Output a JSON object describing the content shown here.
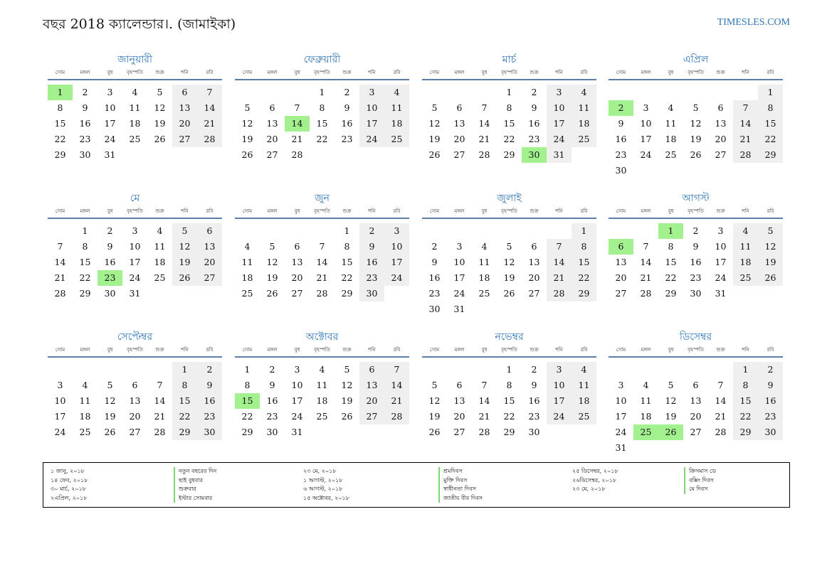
{
  "header": {
    "title": "বছর 2018 ক্যালেন্ডার।. (জামাইকা)",
    "site": "TIMESLES.COM"
  },
  "weekdays": [
    "সোম",
    "মঙ্গল",
    "বুধ",
    "বৃহস্পতি",
    "শুক্র",
    "শনি",
    "রবি"
  ],
  "months": [
    {
      "name": "জানুয়ারী",
      "start": 0,
      "days": 31,
      "holidays": [
        1
      ]
    },
    {
      "name": "ফেব্রুয়ারী",
      "start": 3,
      "days": 28,
      "holidays": [
        14
      ]
    },
    {
      "name": "মার্চ",
      "start": 3,
      "days": 31,
      "holidays": [
        30
      ]
    },
    {
      "name": "এপ্রিল",
      "start": 6,
      "days": 30,
      "holidays": [
        2
      ]
    },
    {
      "name": "মে",
      "start": 1,
      "days": 31,
      "holidays": [
        23
      ]
    },
    {
      "name": "জুন",
      "start": 4,
      "days": 30,
      "holidays": []
    },
    {
      "name": "জুলাই",
      "start": 6,
      "days": 31,
      "holidays": []
    },
    {
      "name": "আগস্ট",
      "start": 2,
      "days": 31,
      "holidays": [
        1,
        6
      ]
    },
    {
      "name": "সেপ্টেম্বর",
      "start": 5,
      "days": 30,
      "holidays": []
    },
    {
      "name": "অক্টোবর",
      "start": 0,
      "days": 31,
      "holidays": [
        15
      ]
    },
    {
      "name": "নভেম্বর",
      "start": 3,
      "days": 30,
      "holidays": []
    },
    {
      "name": "ডিসেম্বর",
      "start": 5,
      "days": 31,
      "holidays": [
        25,
        26
      ]
    }
  ],
  "legend": {
    "columns": [
      {
        "dates": [
          "১ জানু, ২০১৮",
          "১৪ ফেব, ২০১৮",
          "৩০ মার্চ, ২০১৮",
          "২এপ্রিল, ২০১৮"
        ],
        "names": [
          "নতুন বছরের দিন",
          "ছাই বুধবার",
          "শুক্রবার",
          "ইস্টার সোমবার"
        ]
      },
      {
        "dates": [
          "২৩ মে, ২০১৮",
          "১ আগস্ট, ২০১৮",
          "৬ আগস্ট, ২০১৮",
          "১৫ অক্টোবর, ২০১৮"
        ],
        "names": [
          "শ্রমদিবস",
          "মুক্তি দিবস",
          "স্বাধীনতা দিবস",
          "জাতীয় বীর দিবস"
        ]
      },
      {
        "dates": [
          "২৫ ডিসেম্বর, ২০১৮",
          "২৬ডিসেম্বর, ২০১৮",
          "২৩ মে, ২০১৮"
        ],
        "names": [
          "ক্রিসমাস ডে",
          "বক্সিং দিবস",
          "মে দিবস"
        ]
      }
    ]
  },
  "colors": {
    "accent": "#2e75b6",
    "holiday": "#a3f08f",
    "weekend": "#efefef",
    "rule": "#5b7fa6"
  }
}
